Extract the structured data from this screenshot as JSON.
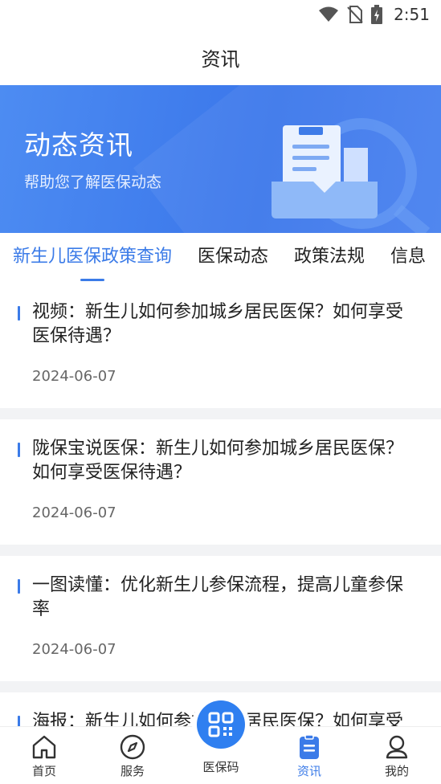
{
  "status_bar": {
    "time": "2:51",
    "icons": [
      "wifi-icon",
      "no-sim-icon",
      "battery-charging-icon"
    ]
  },
  "header": {
    "title": "资讯"
  },
  "banner": {
    "title": "动态资讯",
    "subtitle": "帮助您了解医保动态"
  },
  "tabs": [
    {
      "label": "新生儿医保政策查询",
      "active": true
    },
    {
      "label": "医保动态",
      "active": false
    },
    {
      "label": "政策法规",
      "active": false
    },
    {
      "label": "信息",
      "active": false
    }
  ],
  "news": [
    {
      "title": "视频：新生儿如何参加城乡居民医保？如何享受医保待遇？",
      "date": "2024-06-07"
    },
    {
      "title": "陇保宝说医保：新生儿如何参加城乡居民医保？如何享受医保待遇？",
      "date": "2024-06-07"
    },
    {
      "title": "一图读懂：优化新生儿参保流程，提高儿童参保率",
      "date": "2024-06-07"
    },
    {
      "title": "海报：新生儿如何参加城乡居民医保？如何享受医保待遇？"
    }
  ],
  "bottom_nav": {
    "home": "首页",
    "service": "服务",
    "code": "医保码",
    "news": "资讯",
    "mine": "我的"
  },
  "colors": {
    "accent": "#3b7be8",
    "banner": "#4a86f0"
  }
}
